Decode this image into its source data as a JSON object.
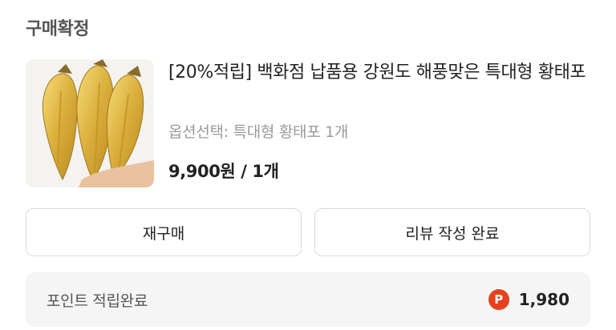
{
  "order": {
    "status": "구매확정",
    "product_title": "[20%적립] 백화점 납품용 강원도 해풍맞은 특대형 황태포",
    "option_text": "옵션선택: 특대형 황태포 1개",
    "price_text": "9,900원 / 1개",
    "thumbnail_icon": "dried-pollack-image"
  },
  "actions": {
    "rebuy_label": "재구매",
    "review_label": "리뷰 작성 완료"
  },
  "points": {
    "label": "포인트 적립완료",
    "icon_letter": "P",
    "amount": "1,980",
    "icon_color": "#e8401c"
  }
}
